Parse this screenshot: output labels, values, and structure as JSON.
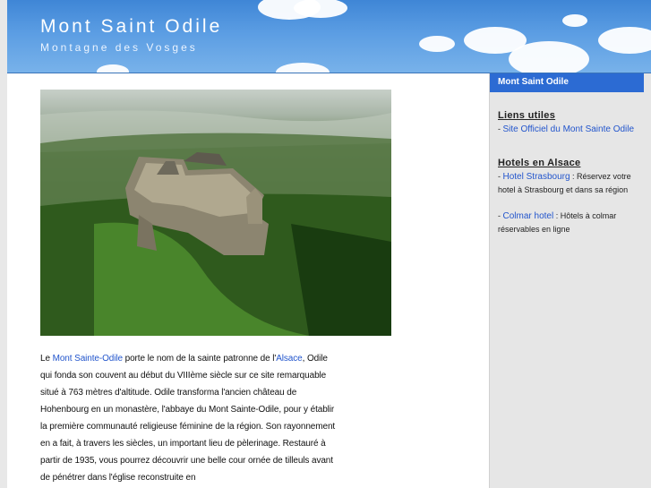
{
  "header": {
    "title": "Mont Saint Odile",
    "subtitle": "Montagne des Vosges"
  },
  "main": {
    "intro": {
      "p1": "Le ",
      "link1": "Mont Sainte-Odile",
      "p2": " porte le nom de la sainte patronne de l'",
      "link2": "Alsace",
      "p3": ", Odile qui fonda son couvent au début du VIIIème siècle sur ce site remarquable situé à 763 mètres d'altitude. Odile transforma l'ancien château de Hohenbourg en un monastère, l'abbaye du Mont Sainte-Odile, pour y établir la première communauté religieuse féminine de la région. Son rayonnement en a fait, à travers les siècles, un important lieu de pèlerinage. Restauré à partir de 1935, vous pourrez découvrir une belle cour ornée de tilleuls avant de pénétrer dans l'église reconstruite en"
    }
  },
  "sidebar": {
    "heading": "Mont Saint Odile",
    "liens": {
      "title": "Liens utiles",
      "item1_prefix": "- ",
      "item1_link": "Site Officiel du Mont Sainte Odile"
    },
    "hotels": {
      "title": "Hotels en Alsace",
      "item1_prefix": "- ",
      "item1_link": "Hotel Strasbourg",
      "item1_text": " : Réservez votre hotel à Strasbourg et dans sa région",
      "item2_prefix": "- ",
      "item2_link": "Colmar hotel",
      "item2_text": " : Hôtels à colmar réservables en ligne"
    }
  },
  "colors": {
    "header_sky": "#5b9de3",
    "sidebar_head": "#2c6bd3",
    "link": "#2255cc",
    "sidebar_bg": "#e6e6e6"
  },
  "icons": {
    "photo": "aerial-photo-mont-sainte-odile"
  }
}
